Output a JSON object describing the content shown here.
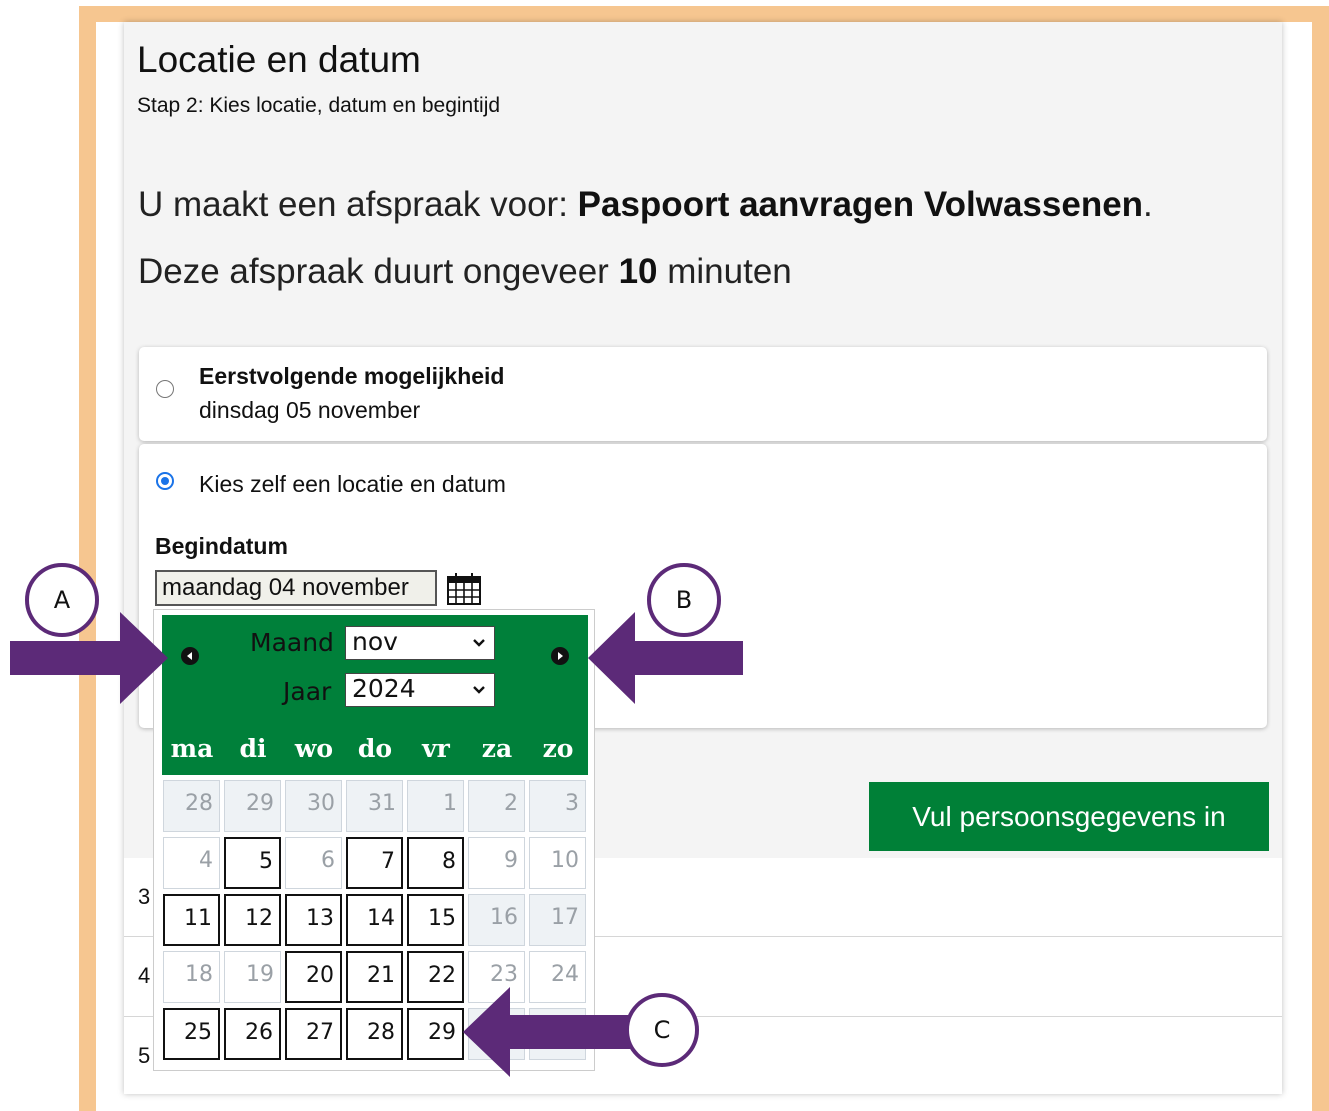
{
  "page": {
    "title": "Locatie en datum",
    "subtitle": "Stap 2: Kies locatie, datum en begintijd",
    "intro_prefix": "U maakt een afspraak voor: ",
    "intro_service": "Paspoort aanvragen Volwassenen",
    "intro_suffix": ".",
    "duration_prefix": "Deze afspraak duurt ongeveer ",
    "duration_value": "10",
    "duration_suffix": " minuten"
  },
  "options": {
    "first_title": "Eerstvolgende mogelijkheid",
    "first_date": "dinsdag 05 november",
    "custom_label": "Kies zelf een locatie en datum",
    "custom_selected": true
  },
  "begindatum": {
    "label": "Begindatum",
    "value": "maandag 04 november",
    "icon": "calendar-icon"
  },
  "next_button": "Vul persoonsgegevens in",
  "row_numbers": [
    "3",
    "4",
    "5"
  ],
  "calendar": {
    "month_label": "Maand",
    "month_value": "nov",
    "year_label": "Jaar",
    "year_value": "2024",
    "prev_icon": "chevron-left-icon",
    "next_icon": "chevron-right-icon",
    "weekdays": [
      "ma",
      "di",
      "wo",
      "do",
      "vr",
      "za",
      "zo"
    ],
    "header_color": "#00803a",
    "weeks": [
      [
        {
          "d": "28",
          "s": "we"
        },
        {
          "d": "29",
          "s": "we"
        },
        {
          "d": "30",
          "s": "we"
        },
        {
          "d": "31",
          "s": "we"
        },
        {
          "d": "1",
          "s": "we"
        },
        {
          "d": "2",
          "s": "we"
        },
        {
          "d": "3",
          "s": "we"
        }
      ],
      [
        {
          "d": "4",
          "s": "dis"
        },
        {
          "d": "5",
          "s": "av"
        },
        {
          "d": "6",
          "s": "dis"
        },
        {
          "d": "7",
          "s": "av"
        },
        {
          "d": "8",
          "s": "av"
        },
        {
          "d": "9",
          "s": "dis"
        },
        {
          "d": "10",
          "s": "dis"
        }
      ],
      [
        {
          "d": "11",
          "s": "av"
        },
        {
          "d": "12",
          "s": "av"
        },
        {
          "d": "13",
          "s": "av"
        },
        {
          "d": "14",
          "s": "av"
        },
        {
          "d": "15",
          "s": "av"
        },
        {
          "d": "16",
          "s": "we"
        },
        {
          "d": "17",
          "s": "we"
        }
      ],
      [
        {
          "d": "18",
          "s": "dis"
        },
        {
          "d": "19",
          "s": "dis"
        },
        {
          "d": "20",
          "s": "av"
        },
        {
          "d": "21",
          "s": "av"
        },
        {
          "d": "22",
          "s": "av"
        },
        {
          "d": "23",
          "s": "dis"
        },
        {
          "d": "24",
          "s": "dis"
        }
      ],
      [
        {
          "d": "25",
          "s": "av"
        },
        {
          "d": "26",
          "s": "av"
        },
        {
          "d": "27",
          "s": "av"
        },
        {
          "d": "28",
          "s": "av"
        },
        {
          "d": "29",
          "s": "av"
        },
        {
          "d": "",
          "s": "we"
        },
        {
          "d": "",
          "s": "we"
        }
      ]
    ]
  },
  "annotations": {
    "a": "A",
    "b": "B",
    "c": "C",
    "color": "#5c2a78"
  }
}
